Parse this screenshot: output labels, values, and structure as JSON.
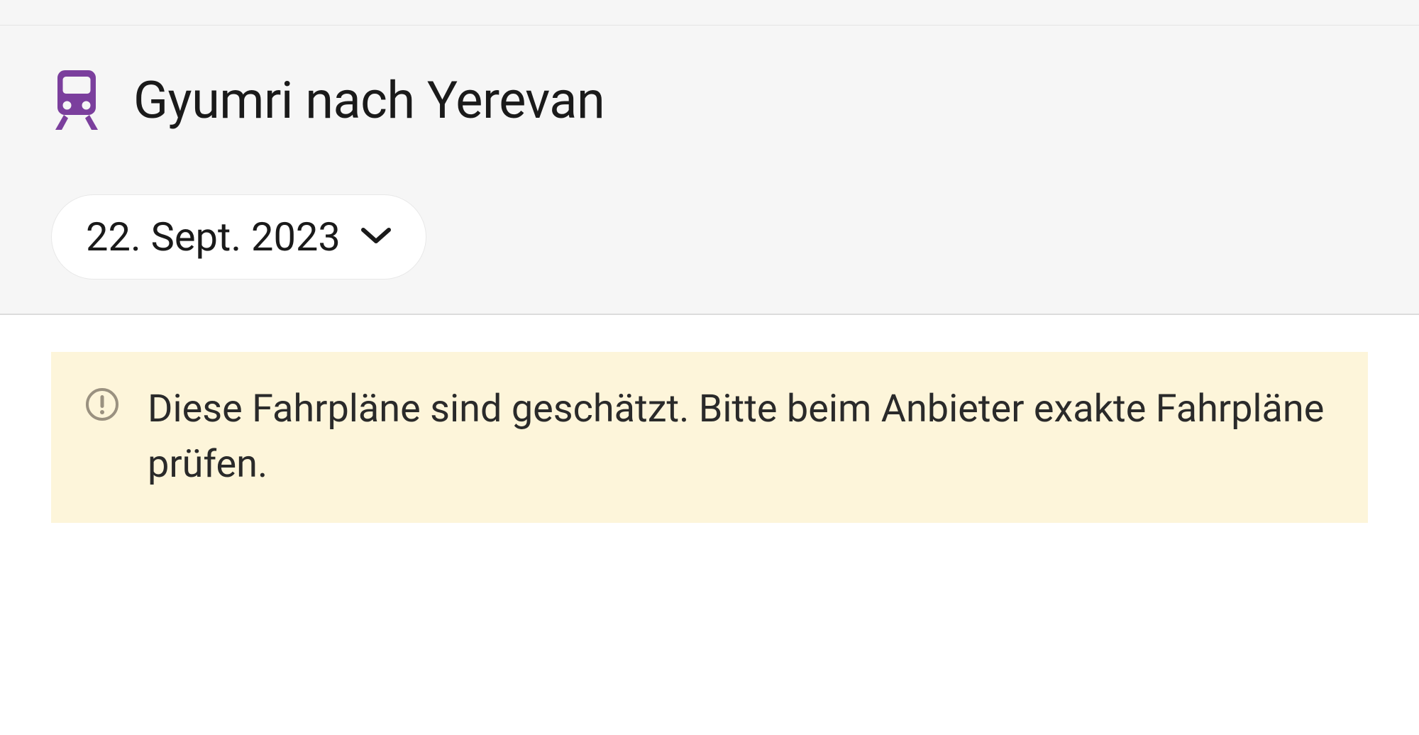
{
  "header": {
    "route_title": "Gyumri nach Yerevan",
    "date_label": "22. Sept. 2023"
  },
  "warning": {
    "message": "Diese Fahrpläne sind geschätzt. Bitte beim Anbieter exakte Fahrpläne prüfen."
  },
  "colors": {
    "train_icon": "#7b3f9d",
    "warning_bg": "#fdf5da",
    "warning_icon": "#9a9180"
  }
}
